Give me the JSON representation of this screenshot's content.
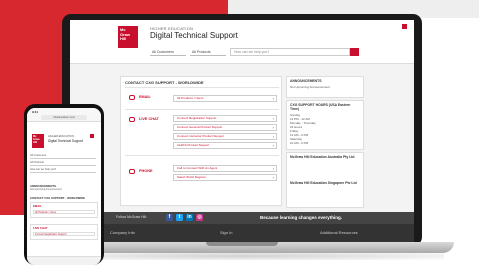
{
  "header": {
    "brand_logo_text": "Mc Graw Hill",
    "subtitle": "HIGHER EDUCATION",
    "title": "Digital Technical Support",
    "filter_customers": "All Customers",
    "filter_products": "All Products",
    "search_placeholder": "How can we help you?"
  },
  "main": {
    "panel_title": "CONTACT CXG SUPPORT - WORLDWIDE",
    "sections": {
      "email": {
        "label": "EMAIL",
        "rows": [
          "All Products / Users"
        ]
      },
      "live_chat": {
        "label": "LIVE CHAT",
        "rows": [
          "Connect Registration Support",
          "Connect General Product Support",
          "Connect Instructor Product Support",
          "ALEKS Product Support"
        ]
      },
      "phone": {
        "label": "PHONE",
        "rows": [
          "Call to Connect With An Agent",
          "Select World Regions"
        ]
      }
    }
  },
  "sidebar": {
    "announcements_title": "ANNOUNCEMENTS",
    "announcements_text": "Not Upcoming Announcement",
    "hours_title": "CXG SUPPORT HOURS (USA Eastern Time)",
    "hours": [
      "Sunday",
      "12 PM - 12 AM",
      "Monday - Thursday",
      "24 Hours",
      "Friday",
      "12 AM - 9 PM",
      "Saturday",
      "10 AM - 6 PM"
    ],
    "address_title": "McGraw Hill Education Australia Pty Ltd",
    "address_title_2": "McGraw Hill Education Singapore Pte Ltd"
  },
  "footer": {
    "follow_label": "Follow McGraw Hill:",
    "tagline": "Because learning changes everything.",
    "links": [
      "Company Info",
      "Sign In",
      "Additional Resources"
    ]
  },
  "phone": {
    "time": "9:41",
    "url": "mheducation.com",
    "subtitle": "HIGHER EDUCATION",
    "title": "Digital Technical Support",
    "announcements_title": "ANNOUNCEMENTS",
    "announcements_text": "Not Upcoming Announcement",
    "panel_title": "CONTACT CXG SUPPORT - WORLDWIDE",
    "email_label": "EMAIL",
    "email_row": "All Products / Users",
    "chat_label": "LIVE CHAT",
    "chat_row": "Connect Registration Support"
  },
  "colors": {
    "brand_red": "#c8102e",
    "backdrop_red": "#d7282f"
  }
}
